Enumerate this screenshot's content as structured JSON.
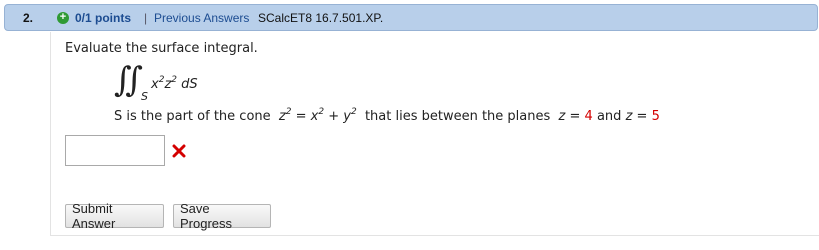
{
  "header": {
    "question_number": "2.",
    "points": "0/1 points",
    "separator": "|",
    "previous_answers": "Previous Answers",
    "problem_code": "SCalcET8 16.7.501.XP."
  },
  "question": {
    "prompt": "Evaluate the surface integral.",
    "integrand_x": "x",
    "integrand_z": "z",
    "exp2": "2",
    "dS": "dS",
    "domain_letter": "S",
    "desc_start": "S is the part of the cone",
    "cone_z": "z",
    "cone_eq": "= x",
    "cone_plus": "+ y",
    "desc_mid": "that lies between the planes",
    "plane1": "z =",
    "plane1_val": "4",
    "and": "and",
    "plane2": "z =",
    "plane2_val": "5"
  },
  "answer": {
    "value": "",
    "status_icon": "red-x-icon"
  },
  "buttons": {
    "submit": "Submit Answer",
    "save": "Save Progress"
  },
  "colors": {
    "header_bg": "#b8cfea",
    "link": "#1c4c91",
    "wrong": "#d40000",
    "plus": "#2f9a34"
  }
}
